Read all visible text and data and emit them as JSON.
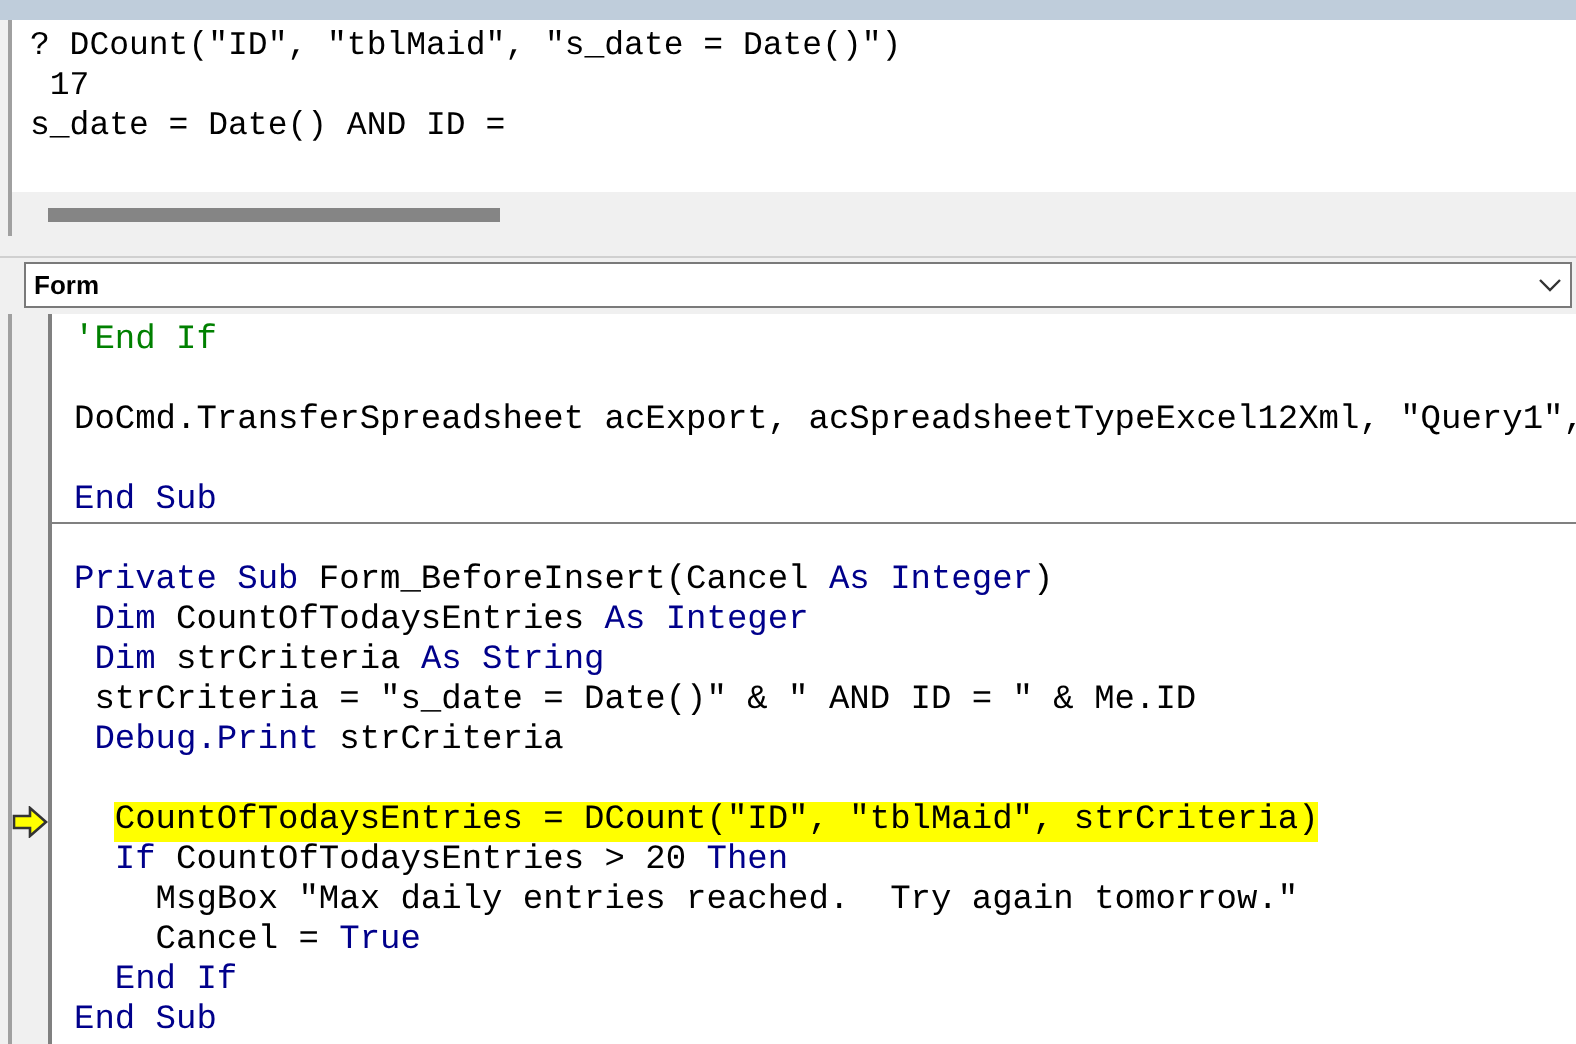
{
  "immediate_window": {
    "lines": [
      "? DCount(\"ID\", \"tblMaid\", \"s_date = Date()\")",
      " 17",
      "s_date = Date() AND ID ="
    ]
  },
  "object_dropdown": {
    "value": "Form"
  },
  "code_lines": [
    {
      "tokens": [
        {
          "text": "'End If",
          "kind": "comment"
        }
      ],
      "separator": false,
      "highlighted": false,
      "current": false
    },
    {
      "separator": false,
      "highlighted": false,
      "current": false
    },
    {
      "tokens": [
        {
          "text": "DoCmd.TransferSpreadsheet acExport, acSpreadsheetTypeExcel12Xml, \"Query1\",",
          "kind": "plain"
        }
      ],
      "separator": false,
      "highlighted": false,
      "current": false
    },
    {
      "separator": false,
      "highlighted": false,
      "current": false
    },
    {
      "tokens": [
        {
          "text": "End Sub",
          "kind": "keyword"
        }
      ],
      "separator": false,
      "highlighted": false,
      "current": false
    },
    {
      "separator": true,
      "highlighted": false,
      "current": false
    },
    {
      "tokens": [
        {
          "text": "Private Sub",
          "kind": "keyword"
        },
        {
          "text": " Form_BeforeInsert(Cancel ",
          "kind": "plain"
        },
        {
          "text": "As Integer",
          "kind": "keyword"
        },
        {
          "text": ")",
          "kind": "plain"
        }
      ],
      "separator": false,
      "highlighted": false,
      "current": false
    },
    {
      "tokens": [
        {
          "text": " Dim",
          "kind": "keyword"
        },
        {
          "text": " CountOfTodaysEntries ",
          "kind": "plain"
        },
        {
          "text": "As Integer",
          "kind": "keyword"
        }
      ],
      "separator": false,
      "highlighted": false,
      "current": false
    },
    {
      "tokens": [
        {
          "text": " Dim",
          "kind": "keyword"
        },
        {
          "text": " strCriteria ",
          "kind": "plain"
        },
        {
          "text": "As String",
          "kind": "keyword"
        }
      ],
      "separator": false,
      "highlighted": false,
      "current": false
    },
    {
      "tokens": [
        {
          "text": " strCriteria = \"s_date = Date()\" & \" AND ID = \" & Me.ID",
          "kind": "plain"
        }
      ],
      "separator": false,
      "highlighted": false,
      "current": false
    },
    {
      "tokens": [
        {
          "text": " Debug.Print",
          "kind": "keyword"
        },
        {
          "text": " strCriteria",
          "kind": "plain"
        }
      ],
      "separator": false,
      "highlighted": false,
      "current": false
    },
    {
      "separator": false,
      "highlighted": false,
      "current": false
    },
    {
      "tokens": [
        {
          "text": "  CountOfTodaysEntries = DCount(\"ID\", \"tblMaid\", strCriteria)",
          "kind": "plain"
        }
      ],
      "separator": false,
      "highlighted": true,
      "current": true
    },
    {
      "tokens": [
        {
          "text": "  If",
          "kind": "keyword"
        },
        {
          "text": " CountOfTodaysEntries > 20 ",
          "kind": "plain"
        },
        {
          "text": "Then",
          "kind": "keyword"
        }
      ],
      "separator": false,
      "highlighted": false,
      "current": false
    },
    {
      "tokens": [
        {
          "text": "    MsgBox \"Max daily entries reached.  Try again tomorrow.\"",
          "kind": "plain"
        }
      ],
      "separator": false,
      "highlighted": false,
      "current": false
    },
    {
      "tokens": [
        {
          "text": "    Cancel = ",
          "kind": "plain"
        },
        {
          "text": "True",
          "kind": "keyword"
        }
      ],
      "separator": false,
      "highlighted": false,
      "current": false
    },
    {
      "tokens": [
        {
          "text": "  End If",
          "kind": "keyword"
        }
      ],
      "separator": false,
      "highlighted": false,
      "current": false
    },
    {
      "tokens": [
        {
          "text": "End Sub",
          "kind": "keyword"
        }
      ],
      "separator": false,
      "highlighted": false,
      "current": false
    }
  ]
}
